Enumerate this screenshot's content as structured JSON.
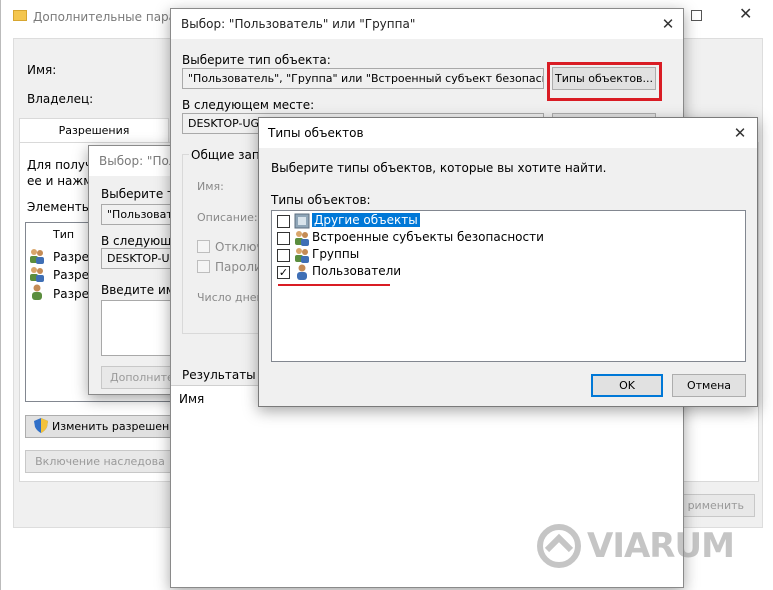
{
  "adv": {
    "title": "Дополнительные параме",
    "name_label": "Имя:",
    "owner_label": "Владелец:",
    "tab_permissions": "Разрешения",
    "info_line1": "Для получе",
    "info_line2": "ее и нажми",
    "elements_label": "Элементы р",
    "col_type": "Тип",
    "rows": [
      "Разре",
      "Разре",
      "Разре"
    ],
    "change_perm_btn": "Изменить разрешени",
    "enable_inherit_btn": "Включение наследова",
    "apply_btn": "рименить"
  },
  "mid": {
    "title": "Выбор: \"Поль",
    "obj_type_label": "Выберите тип",
    "obj_type_value": "\"Пользоват",
    "location_label": "В следующем",
    "location_value": "DESKTOP-UG",
    "enter_label": "Введите имен",
    "advanced_btn": "Дополнител"
  },
  "sel": {
    "title": "Выбор: \"Пользователь\" или \"Группа\"",
    "obj_type_label": "Выберите тип объекта:",
    "obj_type_value": "\"Пользователь\", \"Группа\" или \"Встроенный субъект безопасности\"",
    "obj_types_btn": "Типы объектов...",
    "location_label": "В следующем месте:",
    "location_value": "DESKTOP-UGJ",
    "common_queries": "Общие запро",
    "name_label": "Имя:",
    "desc_label": "Описание:",
    "disabled_label": "Отключе",
    "passwords_label": "Пароли с",
    "days_label": "Число дней",
    "results_label": "Результаты пои",
    "results_col_name": "Имя"
  },
  "types": {
    "title": "Типы объектов",
    "description": "Выберите типы объектов, которые вы хотите найти.",
    "list_label": "Типы объектов:",
    "items": [
      {
        "label": "Другие объекты",
        "checked": "",
        "icon": "other-objects-icon"
      },
      {
        "label": "Встроенные субъекты безопасности",
        "checked": "",
        "icon": "security-principals-icon"
      },
      {
        "label": "Группы",
        "checked": "",
        "icon": "groups-icon"
      },
      {
        "label": "Пользователи",
        "checked": "✓",
        "icon": "user-icon"
      }
    ],
    "ok_btn": "OK",
    "cancel_btn": "Отмена"
  },
  "watermark": "VIARUM",
  "colors": {
    "accent": "#0078d7",
    "highlight": "#d91c24"
  }
}
